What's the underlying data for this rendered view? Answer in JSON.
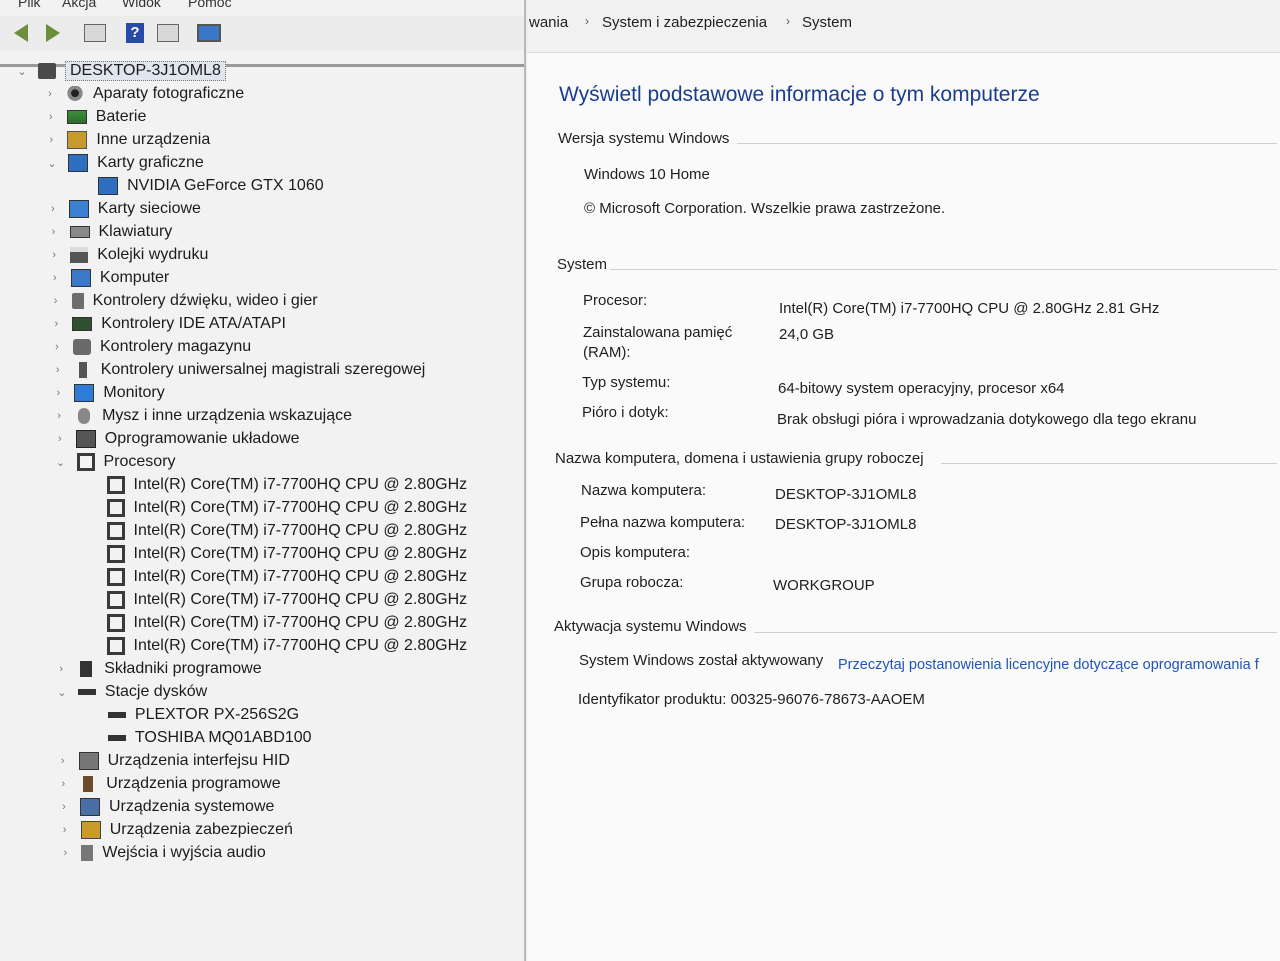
{
  "device_manager": {
    "menu": [
      "Plik",
      "Akcja",
      "Widok",
      "Pomoc"
    ],
    "toolbar_icons": [
      "back-arrow-icon",
      "forward-arrow-icon",
      "properties-icon",
      "help-icon",
      "update-driver-icon",
      "scan-monitor-icon"
    ],
    "root": "DESKTOP-3J1OML8",
    "categories": [
      {
        "label": "Aparaty fotograficzne",
        "icon": "camera-icon",
        "expanded": false
      },
      {
        "label": "Baterie",
        "icon": "battery-icon",
        "expanded": false
      },
      {
        "label": "Inne urządzenia",
        "icon": "other-devices-icon",
        "expanded": false
      },
      {
        "label": "Karty graficzne",
        "icon": "display-adapter-icon",
        "expanded": true,
        "children": [
          "NVIDIA GeForce GTX 1060"
        ]
      },
      {
        "label": "Karty sieciowe",
        "icon": "network-adapter-icon",
        "expanded": false
      },
      {
        "label": "Klawiatury",
        "icon": "keyboard-icon",
        "expanded": false
      },
      {
        "label": "Kolejki wydruku",
        "icon": "printer-icon",
        "expanded": false
      },
      {
        "label": "Komputer",
        "icon": "computer-icon",
        "expanded": false
      },
      {
        "label": "Kontrolery dźwięku, wideo i gier",
        "icon": "sound-icon",
        "expanded": false
      },
      {
        "label": "Kontrolery IDE ATA/ATAPI",
        "icon": "ide-controller-icon",
        "expanded": false
      },
      {
        "label": "Kontrolery magazynu",
        "icon": "storage-controller-icon",
        "expanded": false
      },
      {
        "label": "Kontrolery uniwersalnej magistrali szeregowej",
        "icon": "usb-icon",
        "expanded": false
      },
      {
        "label": "Monitory",
        "icon": "monitor-icon",
        "expanded": false
      },
      {
        "label": "Mysz i inne urządzenia wskazujące",
        "icon": "mouse-icon",
        "expanded": false
      },
      {
        "label": "Oprogramowanie układowe",
        "icon": "firmware-icon",
        "expanded": false
      },
      {
        "label": "Procesory",
        "icon": "processor-icon",
        "expanded": true,
        "children": [
          "Intel(R) Core(TM) i7-7700HQ CPU @ 2.80GHz",
          "Intel(R) Core(TM) i7-7700HQ CPU @ 2.80GHz",
          "Intel(R) Core(TM) i7-7700HQ CPU @ 2.80GHz",
          "Intel(R) Core(TM) i7-7700HQ CPU @ 2.80GHz",
          "Intel(R) Core(TM) i7-7700HQ CPU @ 2.80GHz",
          "Intel(R) Core(TM) i7-7700HQ CPU @ 2.80GHz",
          "Intel(R) Core(TM) i7-7700HQ CPU @ 2.80GHz",
          "Intel(R) Core(TM) i7-7700HQ CPU @ 2.80GHz"
        ]
      },
      {
        "label": "Składniki programowe",
        "icon": "software-component-icon",
        "expanded": false
      },
      {
        "label": "Stacje dysków",
        "icon": "disk-drive-icon",
        "expanded": true,
        "children": [
          "PLEXTOR PX-256S2G",
          "TOSHIBA MQ01ABD100"
        ]
      },
      {
        "label": "Urządzenia interfejsu HID",
        "icon": "hid-icon",
        "expanded": false
      },
      {
        "label": "Urządzenia programowe",
        "icon": "software-device-icon",
        "expanded": false
      },
      {
        "label": "Urządzenia systemowe",
        "icon": "system-device-icon",
        "expanded": false
      },
      {
        "label": "Urządzenia zabezpieczeń",
        "icon": "security-device-icon",
        "expanded": false
      },
      {
        "label": "Wejścia i wyjścia audio",
        "icon": "audio-io-icon",
        "expanded": false
      }
    ]
  },
  "control_panel": {
    "breadcrumb": [
      "wania",
      "System i zabezpieczenia",
      "System"
    ],
    "title": "Wyświetl podstawowe informacje o tym komputerze",
    "edition": {
      "heading": "Wersja systemu Windows",
      "name": "Windows 10 Home",
      "copyright": "© Microsoft Corporation. Wszelkie prawa zastrzeżone."
    },
    "system": {
      "heading": "System",
      "rows": [
        {
          "label": "Procesor:",
          "value": "Intel(R) Core(TM) i7-7700HQ CPU @ 2.80GHz   2.81 GHz"
        },
        {
          "label": "Zainstalowana pamięć (RAM):",
          "value": "24,0 GB"
        },
        {
          "label": "Typ systemu:",
          "value": "64-bitowy system operacyjny, procesor x64"
        },
        {
          "label": "Pióro i dotyk:",
          "value": "Brak obsługi pióra i wprowadzania dotykowego dla tego ekranu"
        }
      ]
    },
    "computer_name": {
      "heading": "Nazwa komputera, domena i ustawienia grupy roboczej",
      "rows": [
        {
          "label": "Nazwa komputera:",
          "value": "DESKTOP-3J1OML8"
        },
        {
          "label": "Pełna nazwa komputera:",
          "value": "DESKTOP-3J1OML8"
        },
        {
          "label": "Opis komputera:",
          "value": ""
        },
        {
          "label": "Grupa robocza:",
          "value": "WORKGROUP"
        }
      ]
    },
    "activation": {
      "heading": "Aktywacja systemu Windows",
      "status": "System Windows został aktywowany",
      "license_link": "Przeczytaj postanowienia licencyjne dotyczące oprogramowania f",
      "product_id_label": "Identyfikator produktu:",
      "product_id": "00325-96076-78673-AAOEM"
    }
  }
}
